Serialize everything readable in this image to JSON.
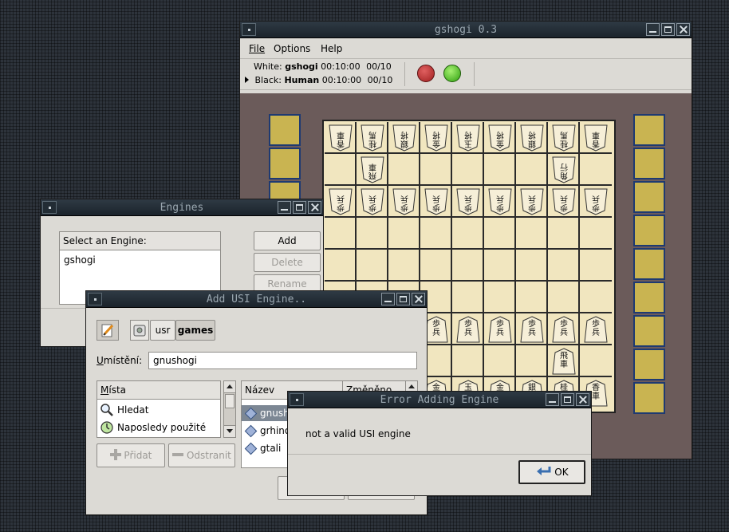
{
  "gshogi": {
    "title": "gshogi 0.3",
    "menu": [
      "File",
      "Options",
      "Help"
    ],
    "white": {
      "label": "White:",
      "name": "gshogi",
      "time": "00:10:00",
      "moves": "00/10"
    },
    "black": {
      "label": "Black:",
      "name": "Human",
      "time": "00:10:00",
      "moves": "00/10"
    },
    "colors": {
      "board_bg": "#6b5b5a",
      "square": "#f1e6bf",
      "hand": "#c9b451",
      "stop": "#b52a2a",
      "go": "#3fb71f"
    }
  },
  "engines": {
    "title": "Engines",
    "list_header": "Select an Engine:",
    "items": [
      "gshogi"
    ],
    "buttons": {
      "add": "Add",
      "delete": "Delete",
      "rename": "Rename"
    }
  },
  "add_usi": {
    "title": "Add USI Engine..",
    "path_buttons": [
      "usr",
      "games"
    ],
    "location_label": "Umístění:",
    "location_value": "gnushogi",
    "places_header": "Místa",
    "places": [
      "Hledat",
      "Naposledy použité"
    ],
    "add_button": "Přidat",
    "remove_button": "Odstranit",
    "files_header_name": "Název",
    "files_header_modified": "Změněno",
    "files": [
      "gnushogi",
      "grhino",
      "gtali"
    ]
  },
  "error": {
    "title": "Error Adding Engine",
    "message": "not a valid USI engine",
    "ok": "OK"
  }
}
